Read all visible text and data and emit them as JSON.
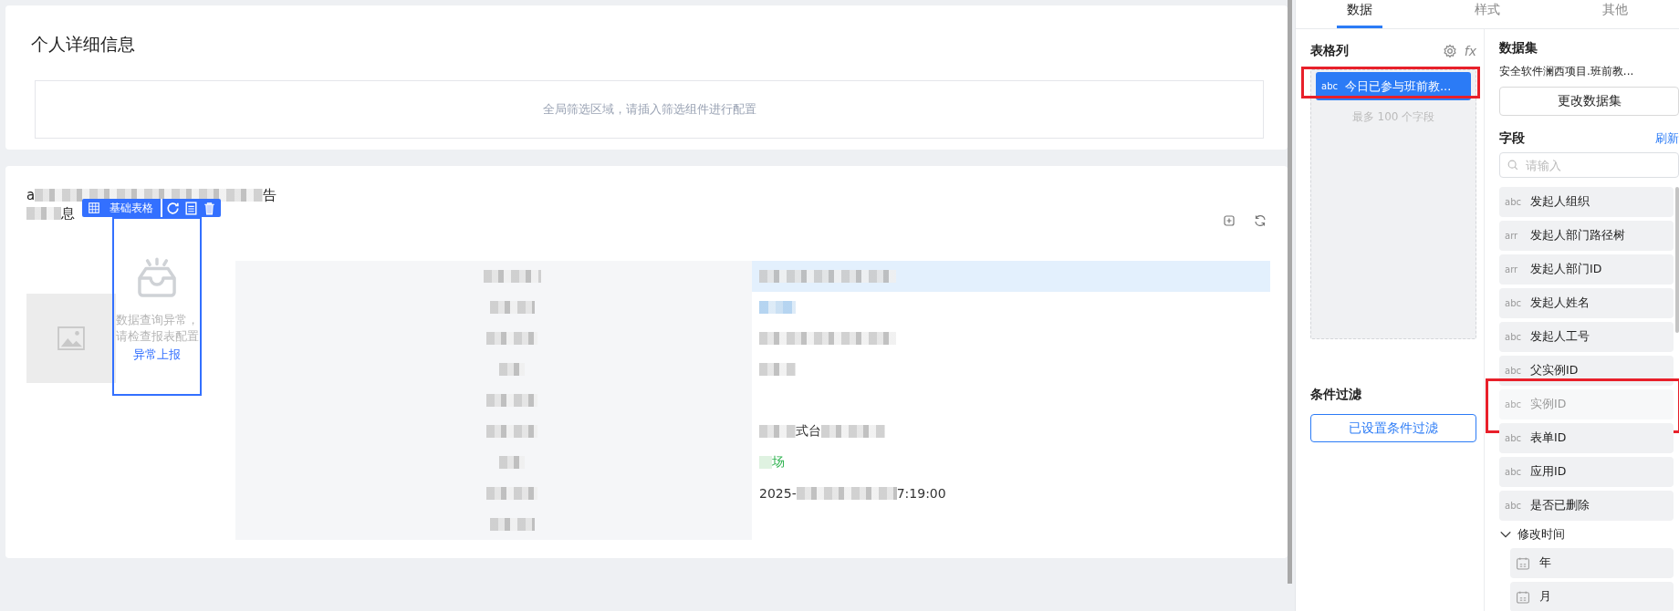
{
  "page": {
    "title": "个人详细信息",
    "filter_placeholder": "全局筛选区域，请插入筛选组件进行配置"
  },
  "report": {
    "header_lines": [
      [
        {
          "kind": "text",
          "text": "a"
        },
        {
          "kind": "redacted"
        },
        {
          "kind": "text",
          "text": "告"
        }
      ],
      [
        {
          "kind": "redacted"
        },
        {
          "kind": "text",
          "text": "息"
        }
      ]
    ],
    "component": {
      "label": "基础表格",
      "error_lines": [
        "数据查询异常，",
        "请检查报表配置"
      ],
      "error_link": "异常上报"
    },
    "rows": [
      {
        "highlighted": true,
        "value": [
          {
            "kind": "redacted"
          }
        ]
      },
      {
        "highlighted": false,
        "value": [
          {
            "kind": "link-redacted"
          }
        ]
      },
      {
        "highlighted": false,
        "value": [
          {
            "kind": "redacted"
          }
        ]
      },
      {
        "highlighted": false,
        "value": [
          {
            "kind": "redacted"
          }
        ]
      },
      {
        "highlighted": false,
        "value": []
      },
      {
        "highlighted": false,
        "value": [
          {
            "kind": "redacted"
          },
          {
            "kind": "text",
            "text": "式台"
          },
          {
            "kind": "redacted"
          }
        ]
      },
      {
        "highlighted": false,
        "value": [
          {
            "kind": "success-redacted"
          },
          {
            "kind": "success-text",
            "text": "场"
          }
        ]
      },
      {
        "highlighted": false,
        "value": [
          {
            "kind": "text",
            "text": "2025-"
          },
          {
            "kind": "redacted"
          },
          {
            "kind": "text",
            "text": "7:19:00"
          }
        ]
      },
      {
        "highlighted": false,
        "value": []
      }
    ]
  },
  "panel": {
    "tabs": [
      {
        "label": "数据",
        "selected": true
      },
      {
        "label": "样式",
        "selected": false
      },
      {
        "label": "其他",
        "selected": false
      }
    ],
    "columns_title": "表格列",
    "formula": "fx",
    "columns": [
      {
        "type": "abc",
        "label": "今日已参与班前教...",
        "highlighted": true
      }
    ],
    "columns_hint": "最多 100 个字段",
    "filter_title": "条件过滤",
    "filter_button": "已设置条件过滤",
    "dataset_title": "数据集",
    "dataset_name": "安全软件澜西项目.班前教...",
    "change_dataset": "更改数据集",
    "fields_title": "字段",
    "refresh": "刷新",
    "search_placeholder": "请输入",
    "fields": [
      {
        "type": "abc",
        "label": "发起人组织",
        "disabled": false,
        "highlighted": false
      },
      {
        "type": "arr",
        "label": "发起人部门路径树",
        "disabled": false,
        "highlighted": false
      },
      {
        "type": "arr",
        "label": "发起人部门ID",
        "disabled": false,
        "highlighted": false
      },
      {
        "type": "abc",
        "label": "发起人姓名",
        "disabled": false,
        "highlighted": false
      },
      {
        "type": "abc",
        "label": "发起人工号",
        "disabled": false,
        "highlighted": false
      },
      {
        "type": "abc",
        "label": "父实例ID",
        "disabled": false,
        "highlighted": false
      },
      {
        "type": "abc",
        "label": "实例ID",
        "disabled": true,
        "highlighted": true
      },
      {
        "type": "abc",
        "label": "表单ID",
        "disabled": false,
        "highlighted": false
      },
      {
        "type": "abc",
        "label": "应用ID",
        "disabled": false,
        "highlighted": false
      },
      {
        "type": "abc",
        "label": "是否已删除",
        "disabled": false,
        "highlighted": false
      }
    ],
    "group": {
      "label": "修改时间",
      "expanded": true,
      "children": [
        {
          "label": "年"
        },
        {
          "label": "月"
        }
      ]
    }
  }
}
